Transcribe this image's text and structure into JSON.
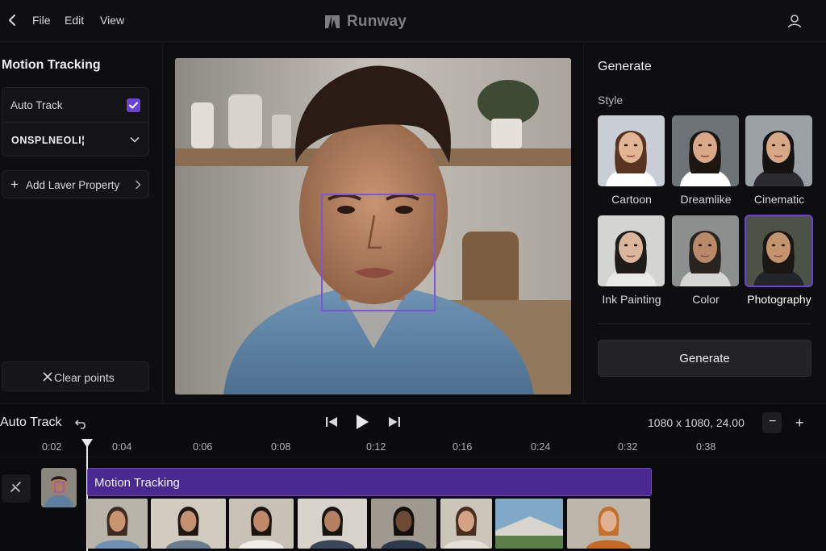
{
  "menu": {
    "file": "File",
    "edit": "Edit",
    "view": "View"
  },
  "brand": "Runway",
  "left_panel": {
    "title": "Motion Tracking",
    "auto_track_label": "Auto Track",
    "auto_track_checked": true,
    "target_value": "ONSPLNEOLI¦",
    "add_layer_label": "Add Laver Property",
    "clear_label": "Clear points"
  },
  "generate_panel": {
    "title": "Generate",
    "style_label": "Style",
    "styles": [
      {
        "name": "Cartoon",
        "selected": false
      },
      {
        "name": "Dreamlike",
        "selected": false
      },
      {
        "name": "Cinematic",
        "selected": false
      },
      {
        "name": "Ink Painting",
        "selected": false
      },
      {
        "name": "Color",
        "selected": false
      },
      {
        "name": "Photography",
        "selected": true
      }
    ],
    "generate_label": "Generate"
  },
  "timeline": {
    "title": "Auto Track",
    "resolution": "1080 x 1080, 24.00",
    "zoom_out": "−",
    "zoom_in": "+",
    "ticks": [
      "0:02",
      "0:04",
      "0:06",
      "0:08",
      "0:12",
      "0:16",
      "0:24",
      "0:32",
      "0:38"
    ],
    "clip_label": "Motion Tracking"
  },
  "colors": {
    "accent": "#6a42d6",
    "clip": "#4a2a91",
    "background": "#0e0e10"
  },
  "icons": [
    "back-icon",
    "runway-logo-icon",
    "user-icon",
    "checkbox-icon",
    "chevron-down-icon",
    "plus-icon",
    "chevron-right-icon",
    "close-icon",
    "undo-icon",
    "skip-back-icon",
    "play-icon",
    "skip-forward-icon",
    "link-icon"
  ]
}
